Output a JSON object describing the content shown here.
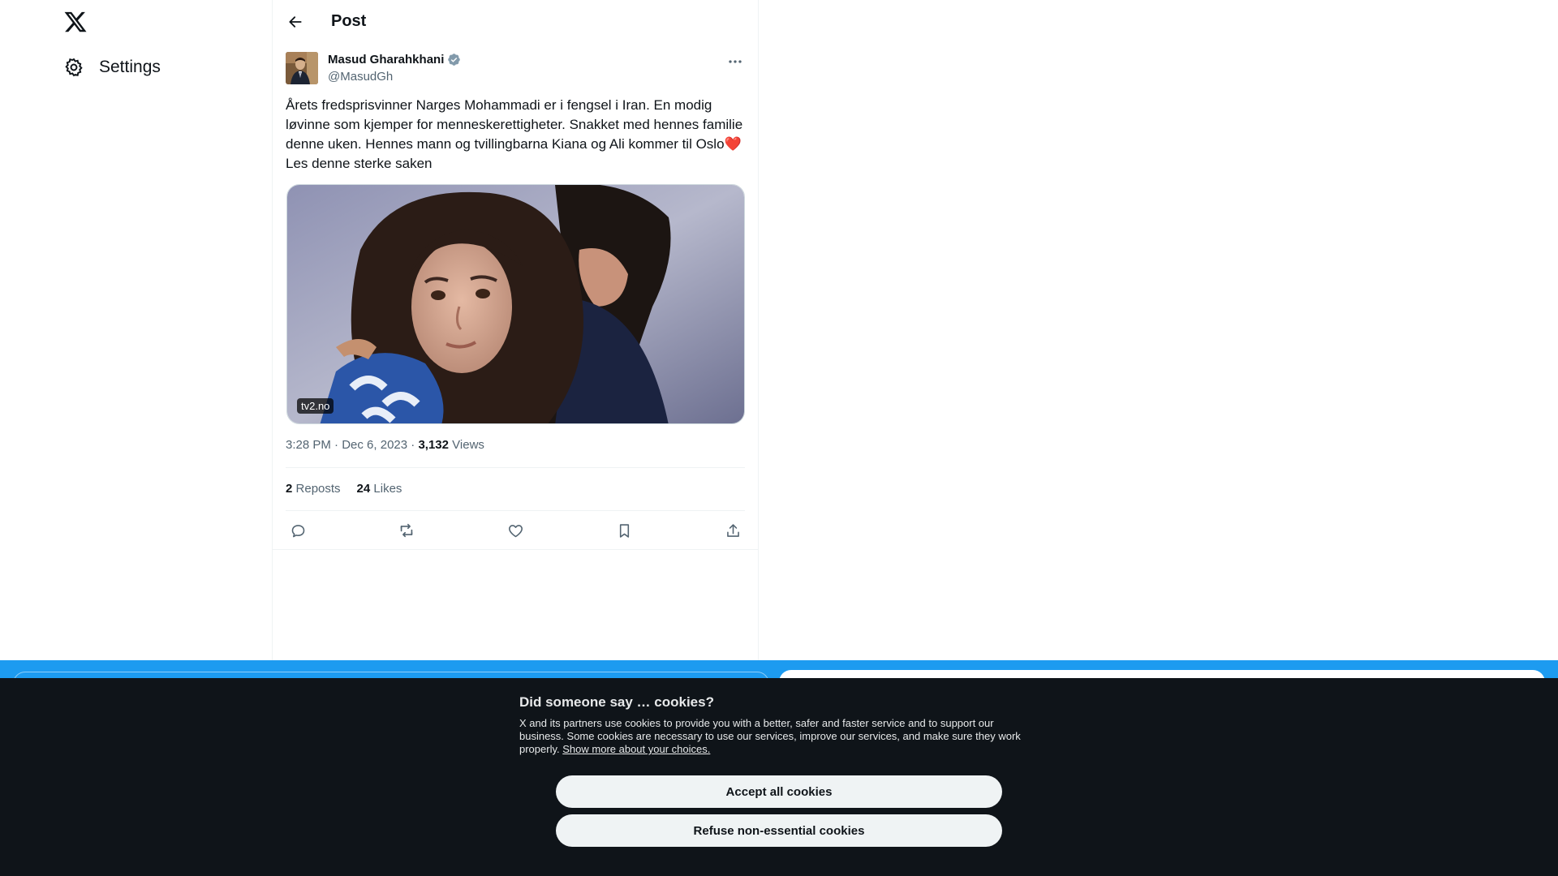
{
  "nav": {
    "logo_icon": "x-logo-icon",
    "settings_icon": "gear-icon",
    "settings_label": "Settings"
  },
  "header": {
    "back_icon": "arrow-left-icon",
    "title": "Post"
  },
  "post": {
    "author_name": "Masud Gharahkhani",
    "author_handle": "@MasudGh",
    "verified_icon": "verified-badge-icon",
    "more_icon": "more-horizontal-icon",
    "text_part1": "Årets fredsprisvinner Narges Mohammadi er i fengsel i Iran. En modig løvinne som kjemper for menneskerettigheter. Snakket med hennes familie denne uken. Hennes mann og tvillingbarna Kiana og Ali kommer til Oslo",
    "text_emoji": "❤️",
    "text_part2": " Les denne sterke saken",
    "media_source": "tv2.no",
    "time": "3:28 PM",
    "date": "Dec 6, 2023",
    "views_count": "3,132",
    "views_label": "Views",
    "reposts_count": "2",
    "reposts_label": "Reposts",
    "likes_count": "24",
    "likes_label": "Likes"
  },
  "actions": [
    {
      "icon": "reply-icon"
    },
    {
      "icon": "repost-icon"
    },
    {
      "icon": "like-icon"
    },
    {
      "icon": "bookmark-icon"
    },
    {
      "icon": "share-icon"
    }
  ],
  "colors": {
    "accent": "#1d9bf0",
    "banner_bg": "#0f1419",
    "text": "#0f1419",
    "secondary_text": "#536471"
  },
  "cookie": {
    "title": "Did someone say … cookies?",
    "body": "X and its partners use cookies to provide you with a better, safer and faster service and to support our business. Some cookies are necessary to use our services, improve our services, and make sure they work properly.",
    "link": "Show more about your choices.",
    "accept_label": "Accept all cookies",
    "refuse_label": "Refuse non-essential cookies"
  }
}
